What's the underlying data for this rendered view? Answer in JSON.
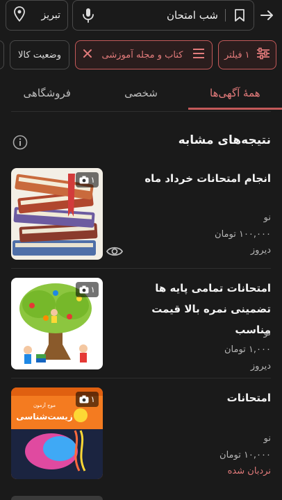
{
  "search": {
    "query": "شب امتحان",
    "city": "تبریز"
  },
  "filters": {
    "filter_count_label": "۱ فیلتر",
    "category_label": "کتاب و مجله آموزشی",
    "status_label": "وضعیت کالا"
  },
  "tabs": [
    {
      "label": "همهٔ آگهی‌ها"
    },
    {
      "label": "شخصی"
    },
    {
      "label": "فروشگاهی"
    }
  ],
  "section": {
    "title": "نتیجه‌های مشابه"
  },
  "listings": [
    {
      "title": "انجام امتحانات خرداد ماه",
      "condition": "نو",
      "price": "۱۰۰,۰۰۰ تومان",
      "time": "دیروز",
      "photo_count": "۱"
    },
    {
      "title": "امتحانات تمامی پایه ها تضمینی نمره بالا قیمت مناسب",
      "condition": "نو",
      "price": "۱,۰۰۰ تومان",
      "time": "دیروز",
      "photo_count": "۱"
    },
    {
      "title": "امتحانات",
      "condition": "نو",
      "price": "۱۰,۰۰۰ تومان",
      "time": "نردبان شده",
      "photo_count": "۱"
    }
  ],
  "book_cover": {
    "top": "موج آزمون",
    "title": "زیست‌شناسی"
  },
  "colors": {
    "accent": "#c45a5a",
    "accent_text": "#e37b7b",
    "background": "#1a1a1a"
  }
}
